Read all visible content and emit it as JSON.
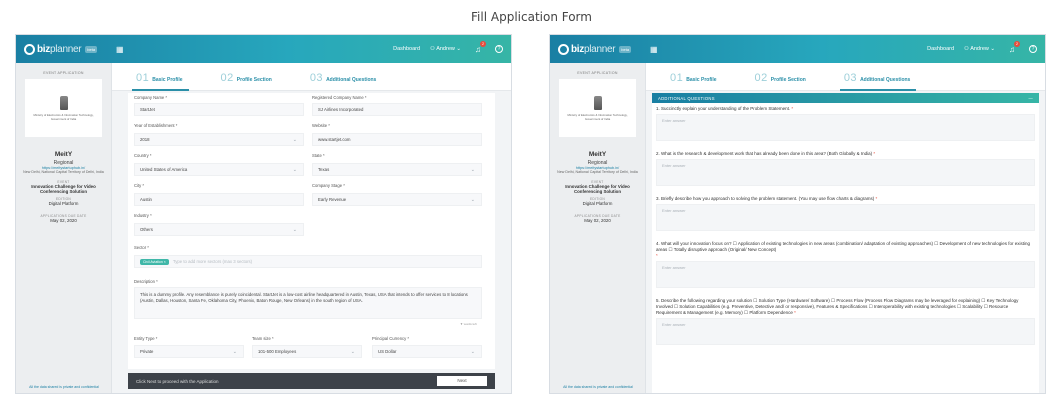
{
  "page_title": "Fill Application Form",
  "topbar": {
    "brand_a": "biz",
    "brand_b": "planner",
    "tag": "beta",
    "dashboard": "Dashboard",
    "user": "Andrew",
    "notifications": "2"
  },
  "sidebar": {
    "head": "EVENT APPLICATION",
    "org_line": "Ministry of Electronics & Information Technology, Government of India",
    "name": "MeitY",
    "region": "Regional",
    "link": "https://meitystartuphub.in/",
    "address": "New Delhi, National Capital Territory of Delhi, India",
    "event_label": "EVENT",
    "event_value": "Innovation Challenge for Video Conferencing Solution",
    "edition_label": "EDITION",
    "edition_value": "Digital Platform",
    "due_label": "APPLICATIONS DUE DATE",
    "due_value": "May 02, 2020",
    "footer": "All the data shared is private and confidential"
  },
  "steps": [
    {
      "num": "01",
      "label": "Basic Profile"
    },
    {
      "num": "02",
      "label": "Profile Section"
    },
    {
      "num": "03",
      "label": "Additional Questions"
    }
  ],
  "form": {
    "company_name_label": "Company Name",
    "company_name": "StartJet",
    "reg_name_label": "Registered Company Name",
    "reg_name": "SJ Airlines Incorporated",
    "year_label": "Year of Establishment",
    "year": "2018",
    "website_label": "Website",
    "website": "www.startjet.com",
    "country_label": "Country",
    "country": "United States of America",
    "state_label": "State",
    "state": "Texas",
    "city_label": "City",
    "city": "Austin",
    "stage_label": "Company Stage",
    "stage": "Early Revenue",
    "industry_label": "Industry",
    "industry": "Others",
    "sector_label": "Sector",
    "sector_chip": "Civil Aviation",
    "sector_placeholder": "Type to add more sectors (max 3 sectors)",
    "description_label": "Description",
    "description": "This is a dummy profile. Any resemblance is purely coincidental. StartJet is a low-cost airline headquartered in Austin, Texas, USA that intends to offer services to 8 locations (Austin, Dallas, Houston, Santa Fe, Oklahoma City, Phoenix, Baton Rouge, New Orleans) in the south region of USA.",
    "limit": "▼ words left",
    "entity_label": "Entity Type",
    "entity": "Private",
    "team_label": "Team size",
    "team": "101-500 Employees",
    "currency_label": "Principal Currency",
    "currency": "US Dollar"
  },
  "bottombar": {
    "text": "Click Next to proceed with the Application",
    "next": "Next"
  },
  "additional": {
    "header": "ADDITIONAL QUESTIONS",
    "collapse": "—",
    "placeholder": "Enter answer",
    "questions": [
      "1. Succinctly explain your understanding of the Problem Statement.",
      "2. What is the research & development work that has already been done in this area? (Both Globally & India)",
      "3. Briefly describe how you approach to solving the problem statement. (You may use flow charts & diagrams)",
      "4. What will your innovation focus on? ☐ Application of existing technologies in new areas (combination/ adaptation of existing approaches) ☐ Development of new technologies for existing areas ☐ Totally disruptive approach (Original/ New Concept)",
      "5. Describe the following regarding your solution ☐ Solution Type (Hardware/ Software) ☐ Process Flow (Process Flow Diagrams may be leveraged for explaining) ☐ Key Technology Involved ☐ Solution Capabilities (e.g. Preventive, Detective and/ or responsive), Features & Specifications ☐ Interoperability with existing technologies ☐ Scalability ☐ Resource Requirement & Management (e.g. Memory) ☐ Platform Dependence"
    ]
  }
}
